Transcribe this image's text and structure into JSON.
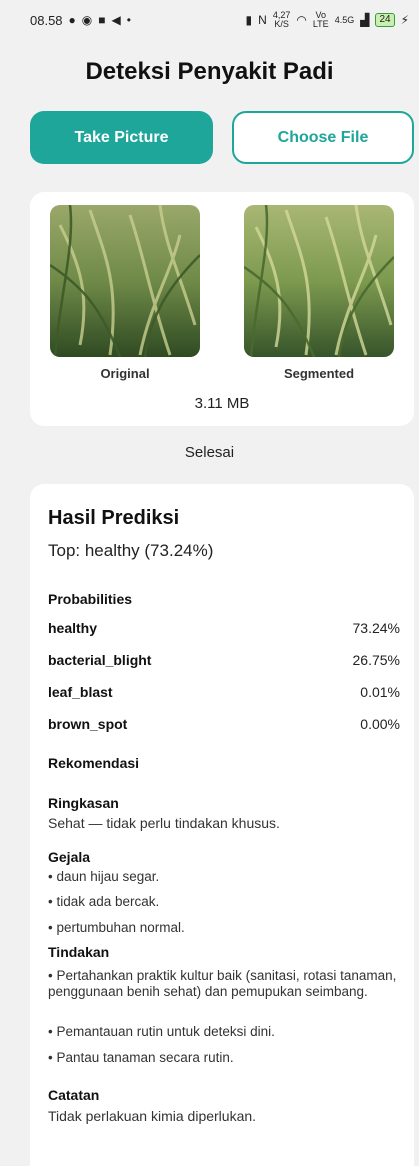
{
  "status_bar": {
    "time": "08.58",
    "speed_value": "4,27",
    "speed_unit": "K/S",
    "volte_top": "Vo",
    "volte_bottom": "LTE",
    "network": "4.5G",
    "battery": "24"
  },
  "app": {
    "title": "Deteksi Penyakit Padi"
  },
  "buttons": {
    "take_picture": "Take Picture",
    "choose_file": "Choose File"
  },
  "images": {
    "original_label": "Original",
    "segmented_label": "Segmented",
    "file_size": "3.11 MB"
  },
  "status": "Selesai",
  "result": {
    "title": "Hasil Prediksi",
    "top": "Top: healthy (73.24%)",
    "probabilities_label": "Probabilities",
    "probabilities": [
      {
        "name": "healthy",
        "value": "73.24%"
      },
      {
        "name": "bacterial_blight",
        "value": "26.75%"
      },
      {
        "name": "leaf_blast",
        "value": "0.01%"
      },
      {
        "name": "brown_spot",
        "value": "0.00%"
      }
    ],
    "recommendation_label": "Rekomendasi",
    "summary_label": "Ringkasan",
    "summary": "Sehat — tidak perlu tindakan khusus.",
    "symptoms_label": "Gejala",
    "symptoms": [
      "• daun hijau segar.",
      "• tidak ada bercak.",
      "• pertumbuhan normal."
    ],
    "actions_label": "Tindakan",
    "actions": [
      "• Pertahankan praktik kultur baik (sanitasi, rotasi tanaman, penggunaan benih sehat) dan pemupukan seimbang.",
      "• Pemantauan rutin untuk deteksi dini.",
      "• Pantau tanaman secara rutin."
    ],
    "notes_label": "Catatan",
    "notes": "Tidak perlakuan kimia diperlukan."
  },
  "colors": {
    "accent": "#1ea69a",
    "background": "#f1f1f1",
    "card": "#ffffff"
  }
}
